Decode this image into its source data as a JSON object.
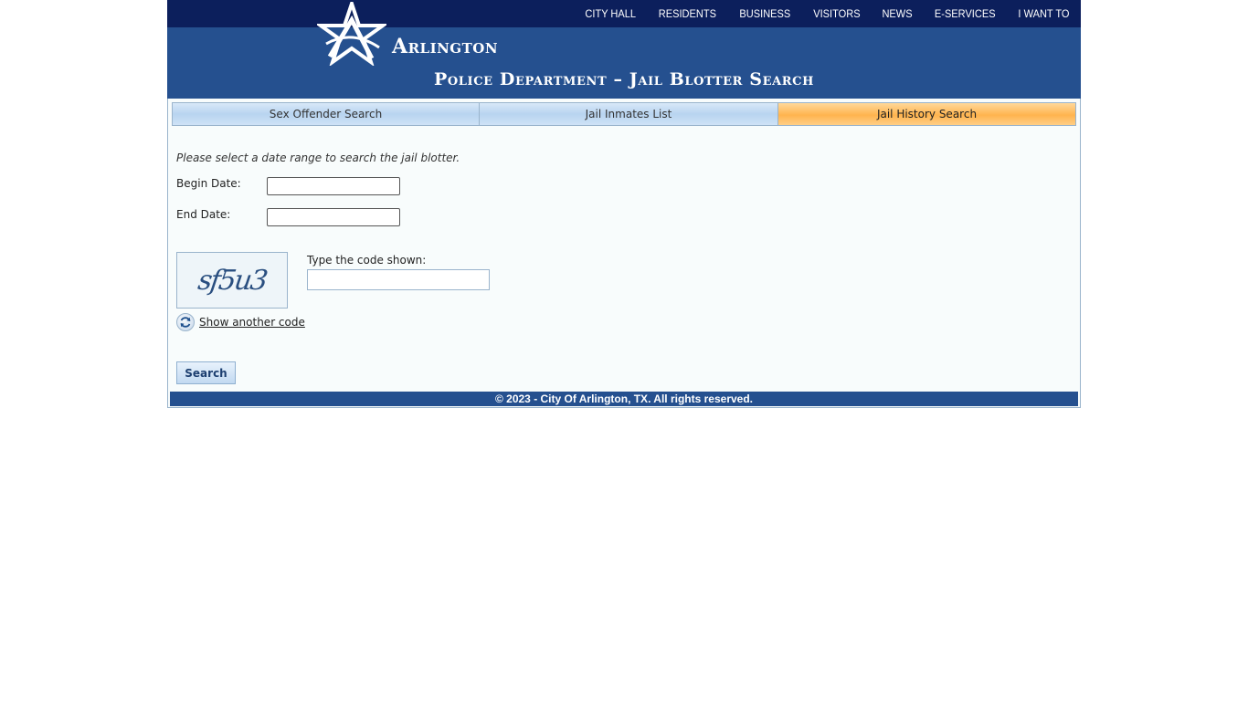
{
  "header": {
    "nav": [
      "CITY HALL",
      "RESIDENTS",
      "BUSINESS",
      "VISITORS",
      "NEWS",
      "E-SERVICES",
      "I WANT TO"
    ],
    "city_name": "Arlington",
    "title": "Police Department – Jail Blotter Search"
  },
  "tabs": [
    {
      "label": "Sex Offender Search",
      "active": false
    },
    {
      "label": "Jail Inmates List",
      "active": false
    },
    {
      "label": "Jail History Search",
      "active": true
    }
  ],
  "form": {
    "intro": "Please select a date range to search the jail blotter.",
    "begin_label": "Begin Date:",
    "begin_value": "",
    "end_label": "End Date:",
    "end_value": "",
    "captcha_text": "sf5u3",
    "code_label": "Type the code shown:",
    "code_value": "",
    "refresh_label": "Show another code",
    "search_label": "Search"
  },
  "footer": {
    "copyright": "© 2023 - City Of Arlington, TX. All rights reserved."
  },
  "colors": {
    "topbar": "#0c1f5c",
    "header": "#25508f",
    "active_tab": "#ffb44e",
    "tab": "#b8d4f0"
  }
}
